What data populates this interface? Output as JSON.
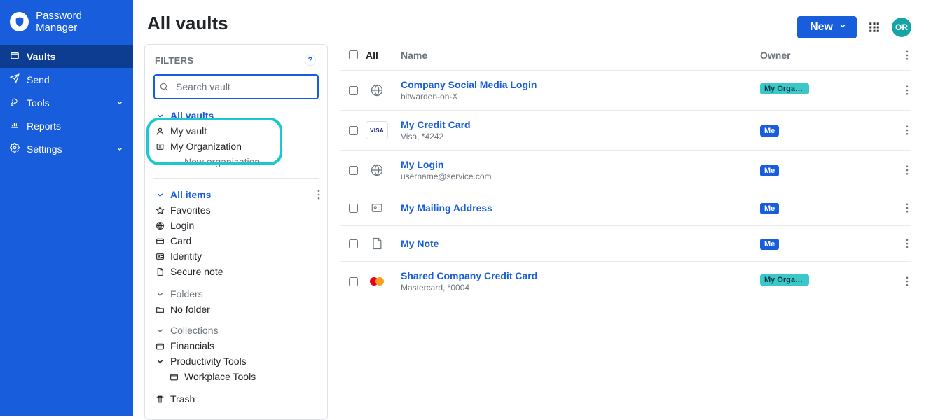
{
  "brand": {
    "name": "Password Manager"
  },
  "nav": {
    "vaults": "Vaults",
    "send": "Send",
    "tools": "Tools",
    "reports": "Reports",
    "settings": "Settings"
  },
  "page_title": "All vaults",
  "topbar": {
    "new_label": "New",
    "avatar_initials": "OR"
  },
  "filters": {
    "title": "FILTERS",
    "search_placeholder": "Search vault",
    "vaults": {
      "all": "All vaults",
      "mine": "My vault",
      "org": "My Organization",
      "new_org": "New organization"
    },
    "types": {
      "all": "All items",
      "favorites": "Favorites",
      "login": "Login",
      "card": "Card",
      "identity": "Identity",
      "secure_note": "Secure note"
    },
    "folders": {
      "label": "Folders",
      "none": "No folder"
    },
    "collections": {
      "label": "Collections",
      "financials": "Financials",
      "productivity": "Productivity Tools",
      "workplace": "Workplace Tools"
    },
    "trash": "Trash"
  },
  "table": {
    "headers": {
      "all": "All",
      "name": "Name",
      "owner": "Owner"
    },
    "owner_me": "Me",
    "owner_org": "My Organiz...",
    "items": [
      {
        "icon": "globe",
        "title": "Company Social Media Login",
        "sub": "bitwarden-on-X",
        "owner": "org"
      },
      {
        "icon": "visa",
        "title": "My Credit Card",
        "sub": "Visa, *4242",
        "owner": "me"
      },
      {
        "icon": "globe",
        "title": "My Login",
        "sub": "username@service.com",
        "owner": "me"
      },
      {
        "icon": "idcard",
        "title": "My Mailing Address",
        "sub": "",
        "owner": "me"
      },
      {
        "icon": "note",
        "title": "My Note",
        "sub": "",
        "owner": "me"
      },
      {
        "icon": "mc",
        "title": "Shared Company Credit Card",
        "sub": "Mastercard, *0004",
        "owner": "org"
      }
    ]
  }
}
